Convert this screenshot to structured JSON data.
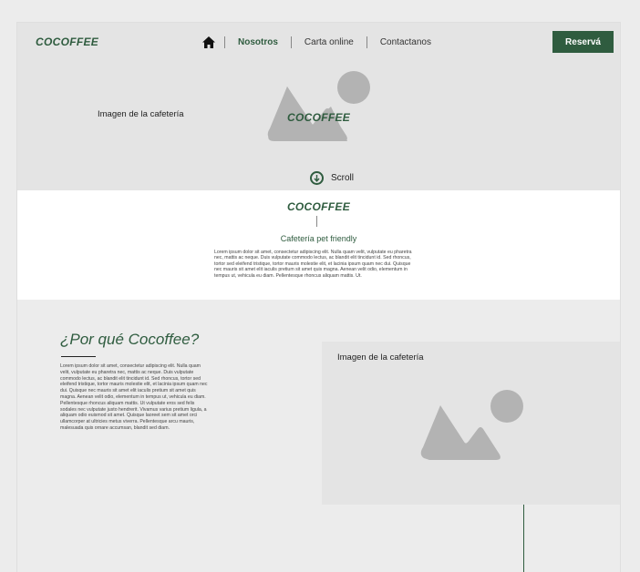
{
  "header": {
    "logo": "COCOFFEE",
    "nav": {
      "home_icon": "home-icon",
      "items": [
        {
          "label": "Nosotros",
          "active": true
        },
        {
          "label": "Carta online",
          "active": false
        },
        {
          "label": "Contactanos",
          "active": false
        }
      ]
    },
    "cta_label": "Reservá"
  },
  "hero": {
    "image_caption": "Imagen de la cafetería",
    "image_icon": "image-placeholder-icon",
    "brand": "COCOFFEE",
    "scroll_label": "Scroll",
    "scroll_icon": "arrow-down-circle-icon"
  },
  "intro": {
    "brand": "COCOFFEE",
    "subtitle": "Cafetería pet friendly",
    "body": "Lorem ipsum dolor sit amet, consectetur adipiscing elit. Nulla quam velit, vulputate eu pharetra nec, mattis ac neque. Duis vulputate commodo lectus, ac blandit elit tincidunt id. Sed rhoncus, tortor sed eleifend tristique, tortor mauris molestie elit, et lacinia ipsum quam nec dui. Quisque nec mauris sit amet elit iaculis pretium sit amet quis magna. Aenean velit odio, elementum in tempus ut, vehicula eu diam. Pellentesque rhoncus aliquam mattis. Ut."
  },
  "why": {
    "title": "¿Por qué Cocoffee?",
    "body": "Lorem ipsum dolor sit amet, consectetur adipiscing elit. Nulla quam velit, vulputate eu pharetra nec, mattis ac neque. Duis vulputate commodo lectus, ac blandit elit tincidunt id. Sed rhoncus, tortor sed eleifend tristique, tortor mauris molestie elit, et lacinia ipsum quam nec dui. Quisque nec mauris sit amet elit iaculis pretium sit amet quis magna. Aenean velit odio, elementum in tempus ut, vehicula eu diam. Pellentesque rhoncus aliquam mattis. Ut vulputate eros sed felis sodales nec vulputate justo hendrerit. Vivamus varius pretium ligula, a aliquam odio euismod sit amet. Quisque laoreet sem sit amet orci ullamcorper at ultricies metus viverra. Pellentesque arcu mauris, malesuada quis ornare accumsan, blandit sed diam.",
    "image_caption": "Imagen de la cafetería",
    "image_icon": "image-placeholder-icon"
  },
  "colors": {
    "brand_green": "#2f5c3f",
    "hero_bg": "#e4e4e4",
    "placeholder_gray": "#b3b3b3"
  }
}
